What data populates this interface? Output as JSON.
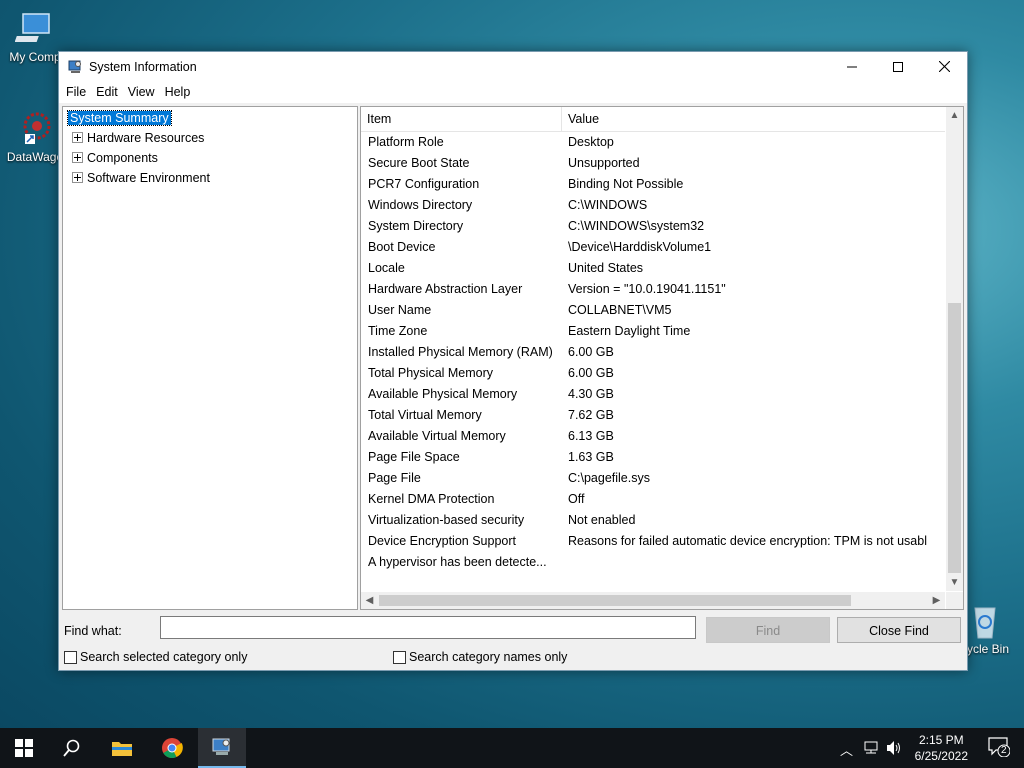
{
  "desktop": {
    "icons": [
      {
        "label": "My Comp"
      },
      {
        "label": "DataWago"
      },
      {
        "label": "cycle Bin"
      }
    ]
  },
  "window": {
    "title": "System Information",
    "menu": [
      "File",
      "Edit",
      "View",
      "Help"
    ],
    "tree": [
      {
        "label": "System Summary",
        "selected": true
      },
      {
        "label": "Hardware Resources"
      },
      {
        "label": "Components"
      },
      {
        "label": "Software Environment"
      }
    ],
    "list": {
      "headers": {
        "item": "Item",
        "value": "Value"
      },
      "rows": [
        {
          "item": "Platform Role",
          "value": "Desktop"
        },
        {
          "item": "Secure Boot State",
          "value": "Unsupported"
        },
        {
          "item": "PCR7 Configuration",
          "value": "Binding Not Possible"
        },
        {
          "item": "Windows Directory",
          "value": "C:\\WINDOWS"
        },
        {
          "item": "System Directory",
          "value": "C:\\WINDOWS\\system32"
        },
        {
          "item": "Boot Device",
          "value": "\\Device\\HarddiskVolume1"
        },
        {
          "item": "Locale",
          "value": "United States"
        },
        {
          "item": "Hardware Abstraction Layer",
          "value": "Version = \"10.0.19041.1151\""
        },
        {
          "item": "User Name",
          "value": "COLLABNET\\VM5"
        },
        {
          "item": "Time Zone",
          "value": "Eastern Daylight Time"
        },
        {
          "item": "Installed Physical Memory (RAM)",
          "value": "6.00 GB"
        },
        {
          "item": "Total Physical Memory",
          "value": "6.00 GB"
        },
        {
          "item": "Available Physical Memory",
          "value": "4.30 GB"
        },
        {
          "item": "Total Virtual Memory",
          "value": "7.62 GB"
        },
        {
          "item": "Available Virtual Memory",
          "value": "6.13 GB"
        },
        {
          "item": "Page File Space",
          "value": "1.63 GB"
        },
        {
          "item": "Page File",
          "value": "C:\\pagefile.sys"
        },
        {
          "item": "Kernel DMA Protection",
          "value": "Off"
        },
        {
          "item": "Virtualization-based security",
          "value": "Not enabled"
        },
        {
          "item": "Device Encryption Support",
          "value": "Reasons for failed automatic device encryption: TPM is not usabl"
        },
        {
          "item": "A hypervisor has been detecte...",
          "value": ""
        }
      ]
    },
    "find": {
      "label": "Find what:",
      "value": "",
      "find_button": "Find",
      "close_button": "Close Find",
      "check_selected": "Search selected category only",
      "check_names": "Search category names only"
    }
  },
  "taskbar": {
    "time": "2:15 PM",
    "date": "6/25/2022",
    "notification_count": "2"
  }
}
